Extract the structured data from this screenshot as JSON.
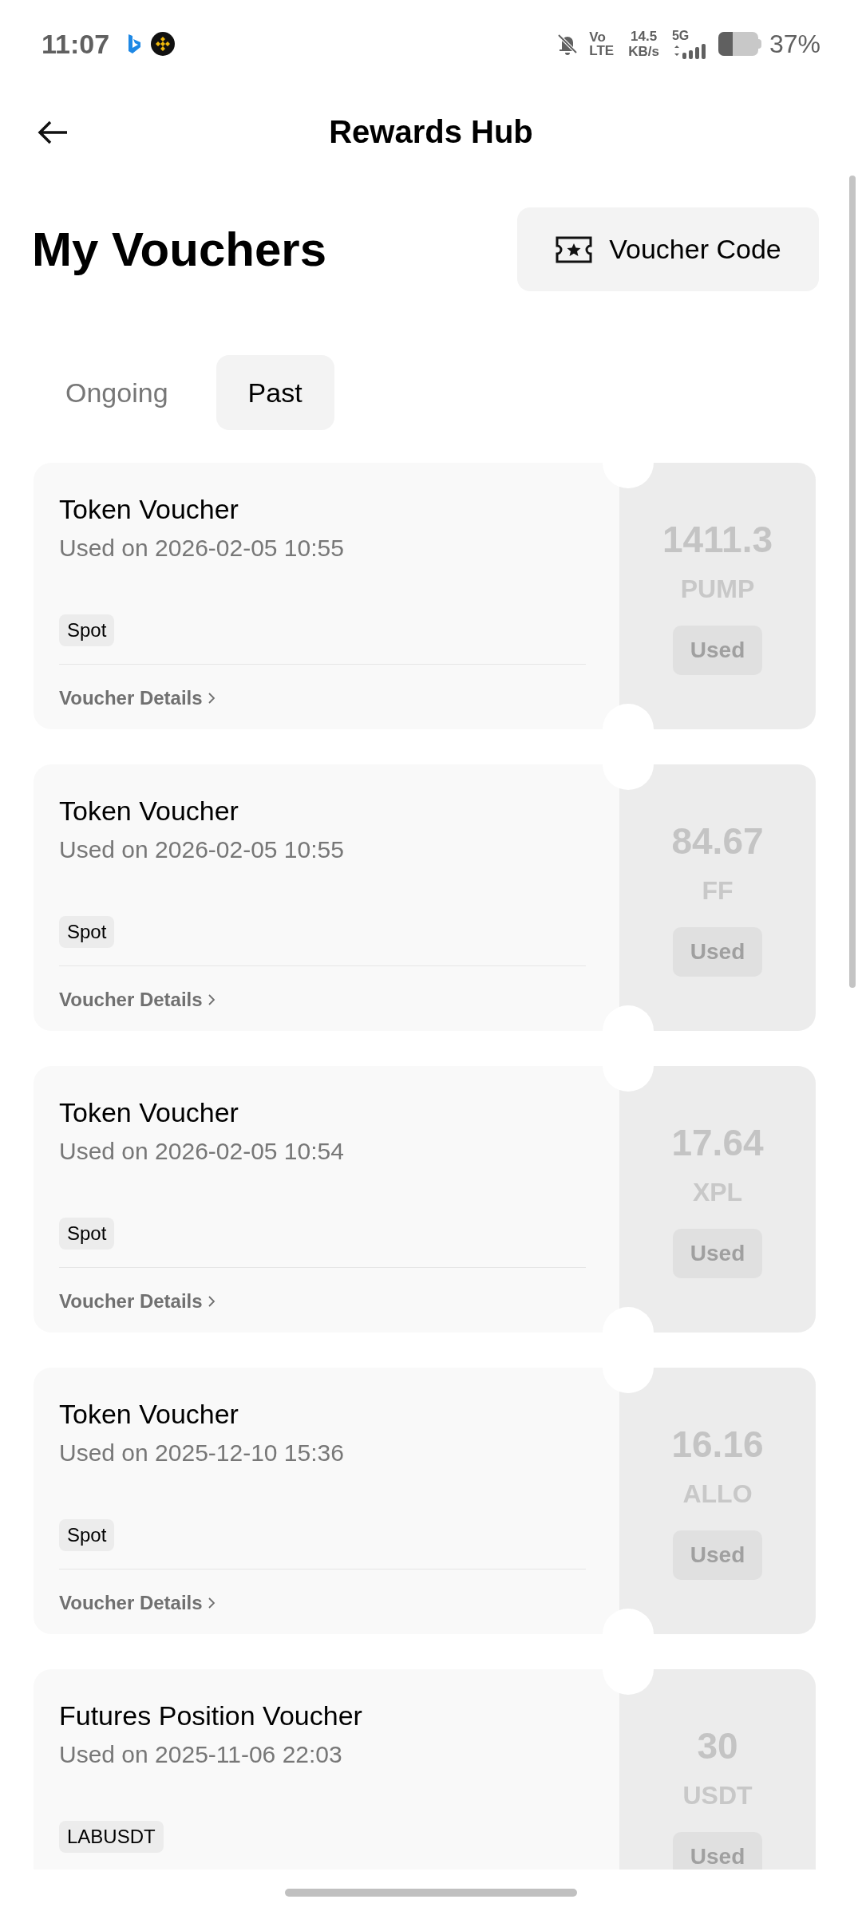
{
  "status_bar": {
    "time": "11:07",
    "volte_top": "Vo",
    "volte_bottom": "LTE",
    "speed_value": "14.5",
    "speed_unit": "KB/s",
    "network": "5G",
    "battery_text": "37%"
  },
  "header": {
    "title": "Rewards Hub"
  },
  "page": {
    "title": "My Vouchers",
    "voucher_code_button": "Voucher Code"
  },
  "tabs": [
    {
      "label": "Ongoing",
      "selected": false
    },
    {
      "label": "Past",
      "selected": true
    }
  ],
  "vouchers": [
    {
      "title": "Token Voucher",
      "date": "Used on 2026-02-05 10:55",
      "tag": "Spot",
      "details": "Voucher Details",
      "amount": "1411.3",
      "unit": "PUMP",
      "status": "Used"
    },
    {
      "title": "Token Voucher",
      "date": "Used on 2026-02-05 10:55",
      "tag": "Spot",
      "details": "Voucher Details",
      "amount": "84.67",
      "unit": "FF",
      "status": "Used"
    },
    {
      "title": "Token Voucher",
      "date": "Used on 2026-02-05 10:54",
      "tag": "Spot",
      "details": "Voucher Details",
      "amount": "17.64",
      "unit": "XPL",
      "status": "Used"
    },
    {
      "title": "Token Voucher",
      "date": "Used on 2025-12-10 15:36",
      "tag": "Spot",
      "details": "Voucher Details",
      "amount": "16.16",
      "unit": "ALLO",
      "status": "Used"
    },
    {
      "title": "Futures Position Voucher",
      "date": "Used on 2025-11-06 22:03",
      "tag": "LABUSDT",
      "amount": "30",
      "unit": "USDT",
      "status": "Used"
    }
  ]
}
